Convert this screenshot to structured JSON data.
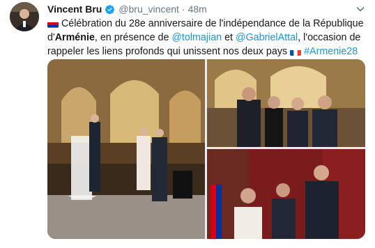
{
  "tweet": {
    "author_name": "Vincent Bru",
    "author_handle": "@bru_vincent",
    "separator": "·",
    "timestamp": "48m",
    "text_part1": "Célébration du 28e anniversaire de l'indépendance de la République d'",
    "text_bold": "Arménie",
    "text_part2": ", en présence de ",
    "mention1": "@tolmajian",
    "text_part3": " et ",
    "mention2": "@GabrielAttal",
    "text_part4": ", l'occasion de rappeler les liens profonds qui unissent nos deux pays",
    "hashtag": "#Armenie28"
  },
  "icons": {
    "verified": "verified-badge-icon",
    "caret": "chevron-down-icon",
    "flag_armenia": "armenia-flag-icon",
    "flag_france": "france-flag-icon"
  },
  "colors": {
    "link": "#1b95e0",
    "verified": "#1da1f2",
    "muted": "#657786"
  }
}
